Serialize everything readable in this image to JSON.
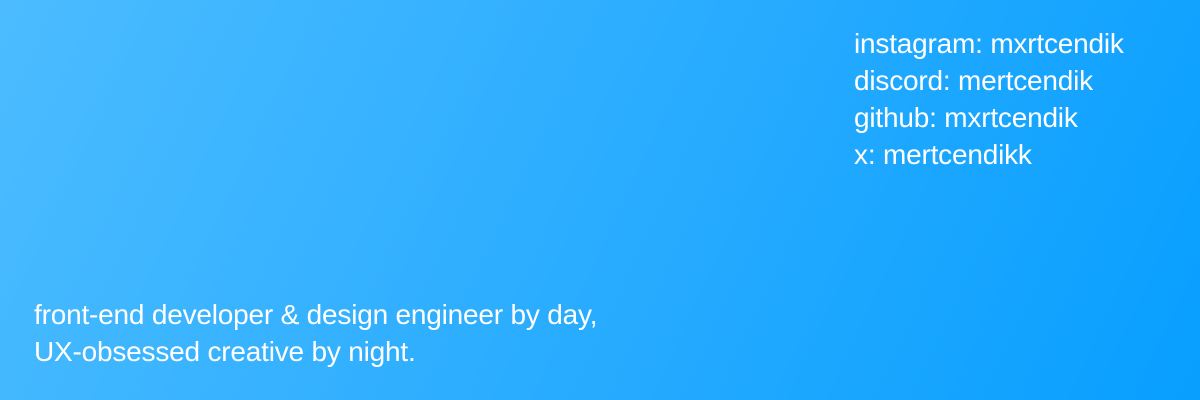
{
  "socials": [
    {
      "label": "instagram",
      "handle": "mxrtcendik"
    },
    {
      "label": "discord",
      "handle": "mertcendik"
    },
    {
      "label": "github",
      "handle": "mxrtcendik"
    },
    {
      "label": "x",
      "handle": "mertcendikk"
    }
  ],
  "tagline": {
    "line1": "front-end developer & design engineer by day,",
    "line2": "UX-obsessed creative by night."
  },
  "colors": {
    "gradient_start": "#4cbcff",
    "gradient_end": "#089fff",
    "text": "#ffffff"
  }
}
